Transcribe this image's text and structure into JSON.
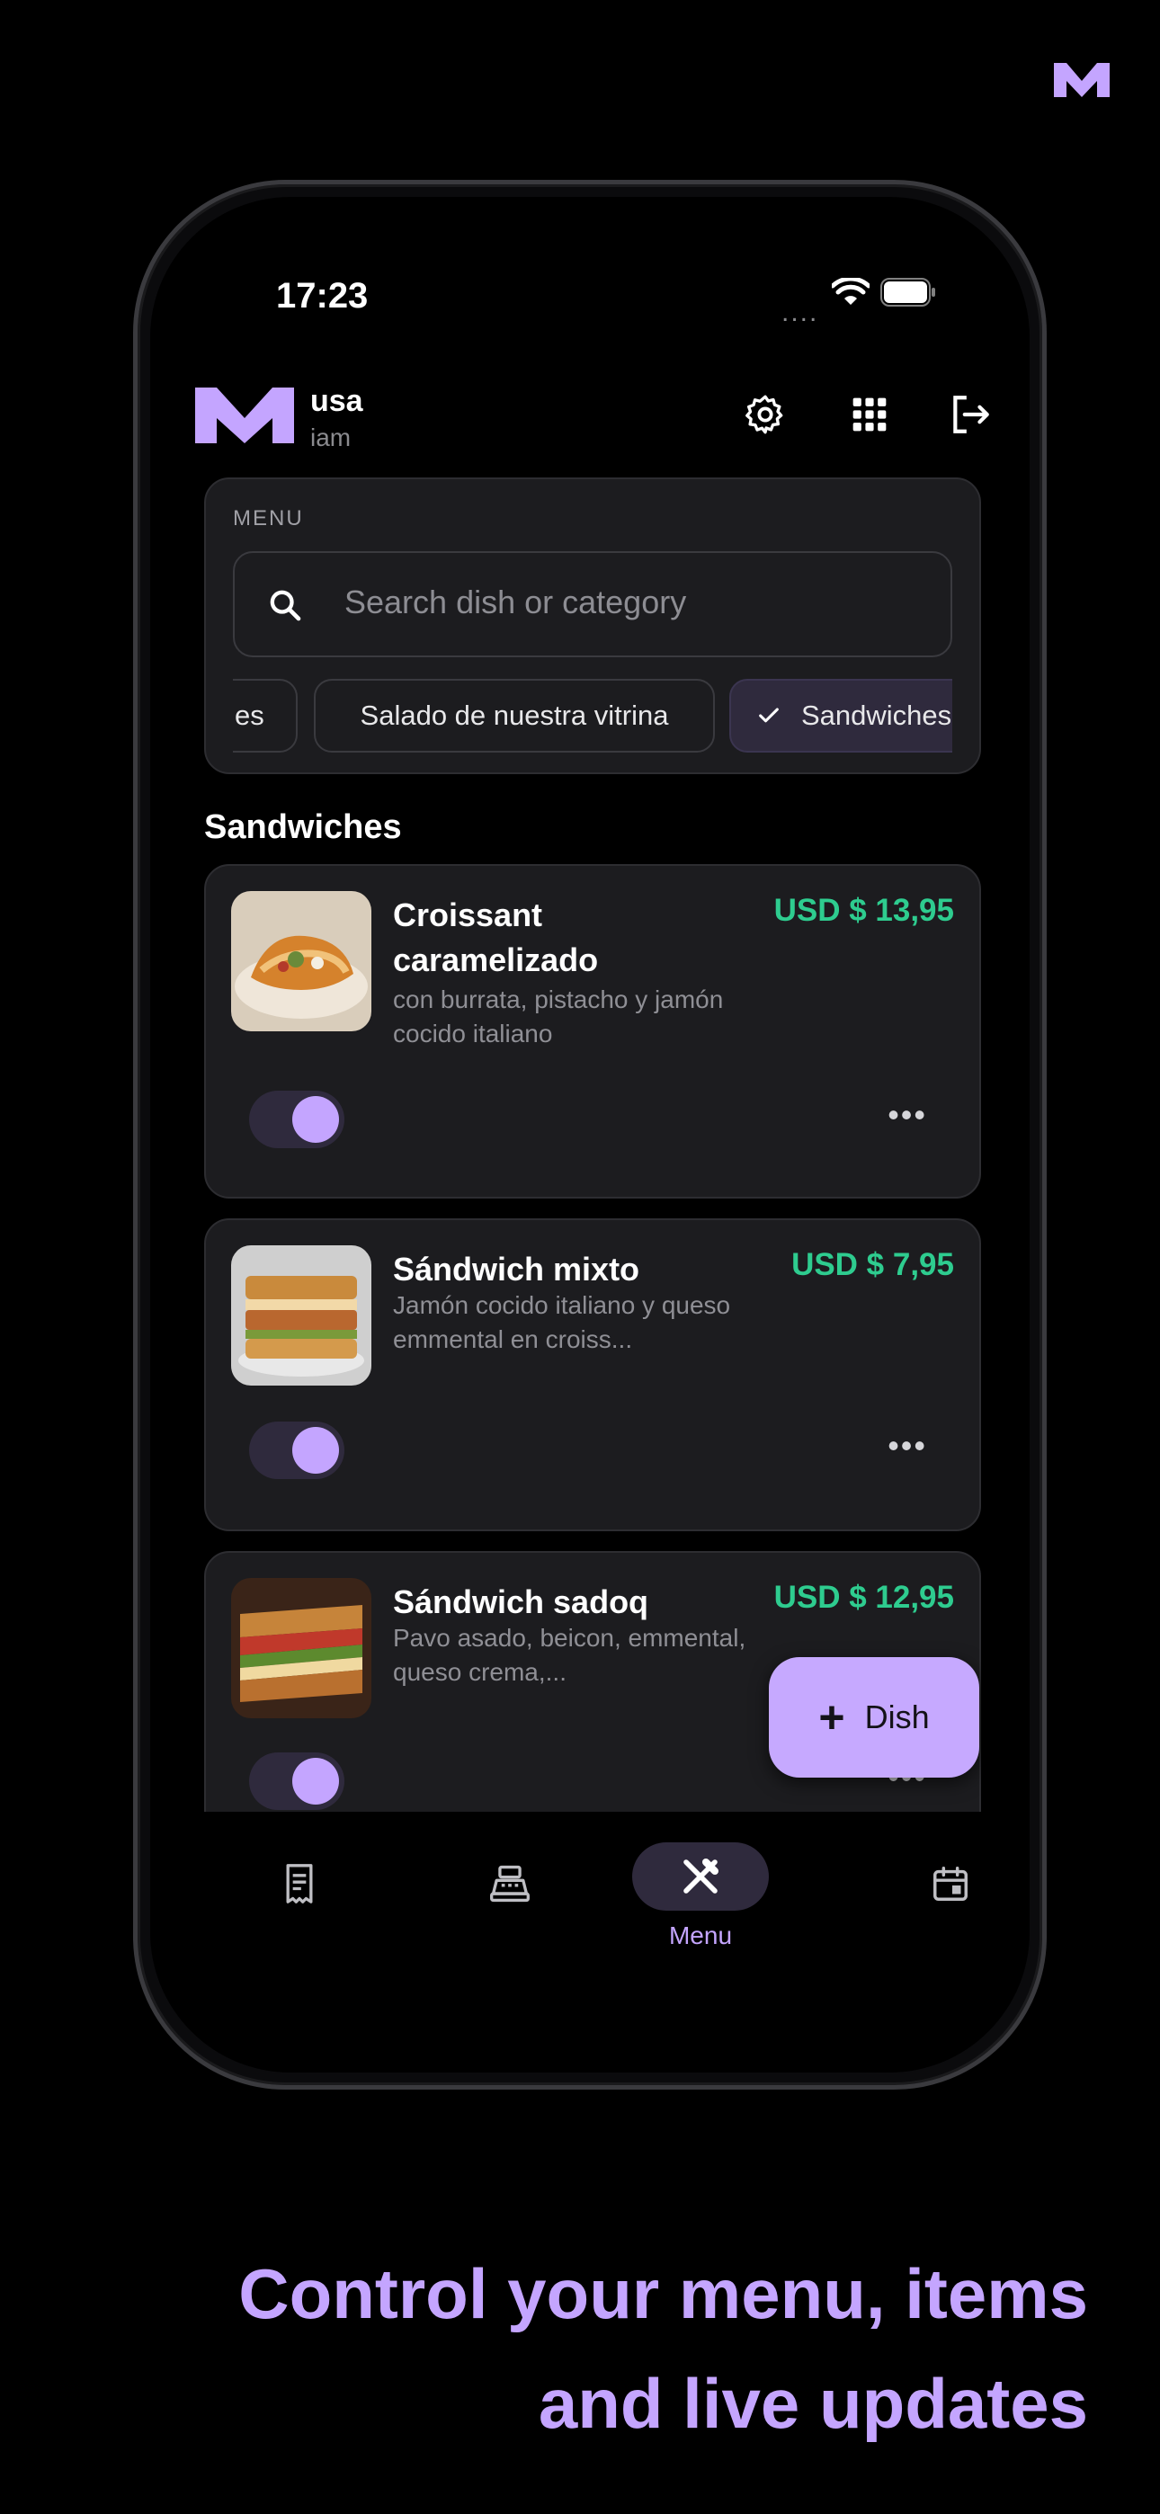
{
  "status_bar": {
    "time": "17:23",
    "dots": "...."
  },
  "header": {
    "account_name": "usa",
    "account_sub": "iam"
  },
  "menu_panel": {
    "label": "MENU",
    "search_placeholder": "Search dish or category",
    "chips": [
      {
        "label": "es",
        "selected": false
      },
      {
        "label": "Salado de nuestra vitrina",
        "selected": false
      },
      {
        "label": "Sandwiches",
        "selected": true
      }
    ]
  },
  "section": {
    "title": "Sandwiches"
  },
  "dishes": [
    {
      "name": "Croissant caramelizado",
      "description": "con burrata, pistacho y jamón cocido italiano",
      "price": "USD $ 13,95",
      "enabled": true
    },
    {
      "name": "Sándwich mixto",
      "description": "Jamón cocido italiano y queso emmental en croiss...",
      "price": "USD $ 7,95",
      "enabled": true
    },
    {
      "name": "Sándwich sadoq",
      "description": "Pavo asado, beicon, emmental, queso crema,...",
      "price": "USD $ 12,95",
      "enabled": true
    }
  ],
  "fab": {
    "plus": "+",
    "label": "Dish"
  },
  "bottom_nav": {
    "items": [
      {
        "icon": "receipt-icon"
      },
      {
        "icon": "cash-register-icon"
      },
      {
        "icon": "fork-knife-icon",
        "label": "Menu",
        "active": true
      },
      {
        "icon": "calendar-icon"
      }
    ]
  },
  "tagline": {
    "line1": "Control your menu, items",
    "line2": "and live updates"
  },
  "colors": {
    "accent": "#c4a5ff",
    "price": "#2ecc8f",
    "card": "#1c1c1f",
    "background": "#000000"
  }
}
